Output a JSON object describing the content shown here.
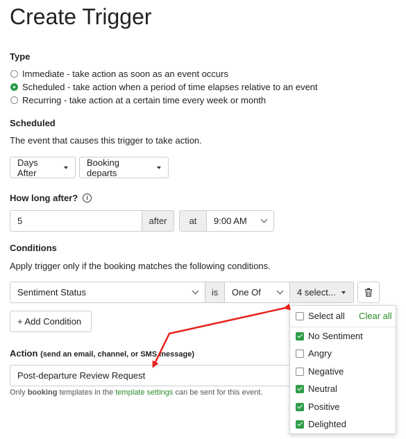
{
  "page_title": "Create Trigger",
  "type_section": {
    "label": "Type",
    "options": [
      {
        "label": "Immediate - take action as soon as an event occurs",
        "checked": false
      },
      {
        "label": "Scheduled - take action when a period of time elapses relative to an event",
        "checked": true
      },
      {
        "label": "Recurring - take action at a certain time every week or month",
        "checked": false
      }
    ]
  },
  "scheduled": {
    "label": "Scheduled",
    "description": "The event that causes this trigger to take action.",
    "unit_select": "Days After",
    "event_select": "Booking departs"
  },
  "how_long": {
    "label": "How long after?",
    "info_icon": "info-icon",
    "value": "5",
    "after_label": "after",
    "at_label": "at",
    "time_select": "9:00 AM"
  },
  "conditions": {
    "label": "Conditions",
    "description": "Apply trigger only if the booking matches the following conditions.",
    "field_select": "Sentiment Status",
    "is_label": "is",
    "operator_select": "One Of",
    "values_select": "4 select...",
    "delete_icon": "trash-icon",
    "add_button": "+ Add Condition"
  },
  "dropdown": {
    "select_all": "Select all",
    "clear_all": "Clear all",
    "items": [
      {
        "label": "No Sentiment",
        "checked": true
      },
      {
        "label": "Angry",
        "checked": false
      },
      {
        "label": "Negative",
        "checked": false
      },
      {
        "label": "Neutral",
        "checked": true
      },
      {
        "label": "Positive",
        "checked": true
      },
      {
        "label": "Delighted",
        "checked": true
      }
    ]
  },
  "action": {
    "label": "Action",
    "sublabel": "(send an email, channel, or SMS message)",
    "value": "Post-departure Review Request",
    "help_prefix": "Only ",
    "help_bold": "booking",
    "help_mid": " templates in the ",
    "help_link": "template settings",
    "help_suffix": " can be sent for this event."
  },
  "colors": {
    "accent": "#2e9d4a",
    "arrow": "#e8231c",
    "link": "#2a8a2a"
  }
}
